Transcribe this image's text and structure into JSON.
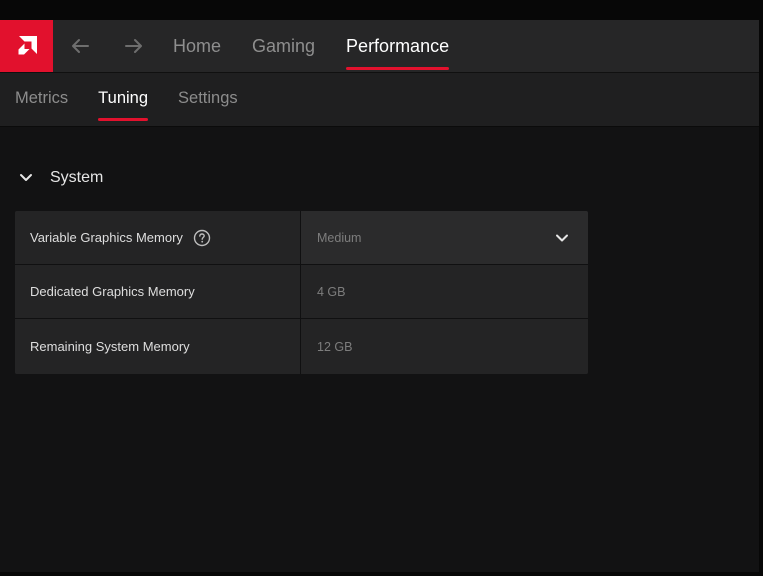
{
  "colors": {
    "accent": "#e2112d",
    "topbar_bg": "#262627",
    "subbar_bg": "#1f1f20",
    "content_bg": "#121213"
  },
  "topbar": {
    "logo_icon": "amd-logo-icon",
    "back_icon": "arrow-left-icon",
    "forward_icon": "arrow-right-icon",
    "tabs": [
      {
        "label": "Home"
      },
      {
        "label": "Gaming"
      },
      {
        "label": "Performance"
      }
    ],
    "active_tab": "Performance"
  },
  "subtabs": {
    "items": [
      {
        "label": "Metrics"
      },
      {
        "label": "Tuning"
      },
      {
        "label": "Settings"
      }
    ],
    "active": "Tuning"
  },
  "section": {
    "title": "System",
    "expanded": true
  },
  "rows": [
    {
      "label": "Variable Graphics Memory",
      "value": "Medium",
      "type": "dropdown",
      "help": true
    },
    {
      "label": "Dedicated Graphics Memory",
      "value": "4 GB",
      "type": "readonly"
    },
    {
      "label": "Remaining System Memory",
      "value": "12 GB",
      "type": "readonly"
    }
  ]
}
